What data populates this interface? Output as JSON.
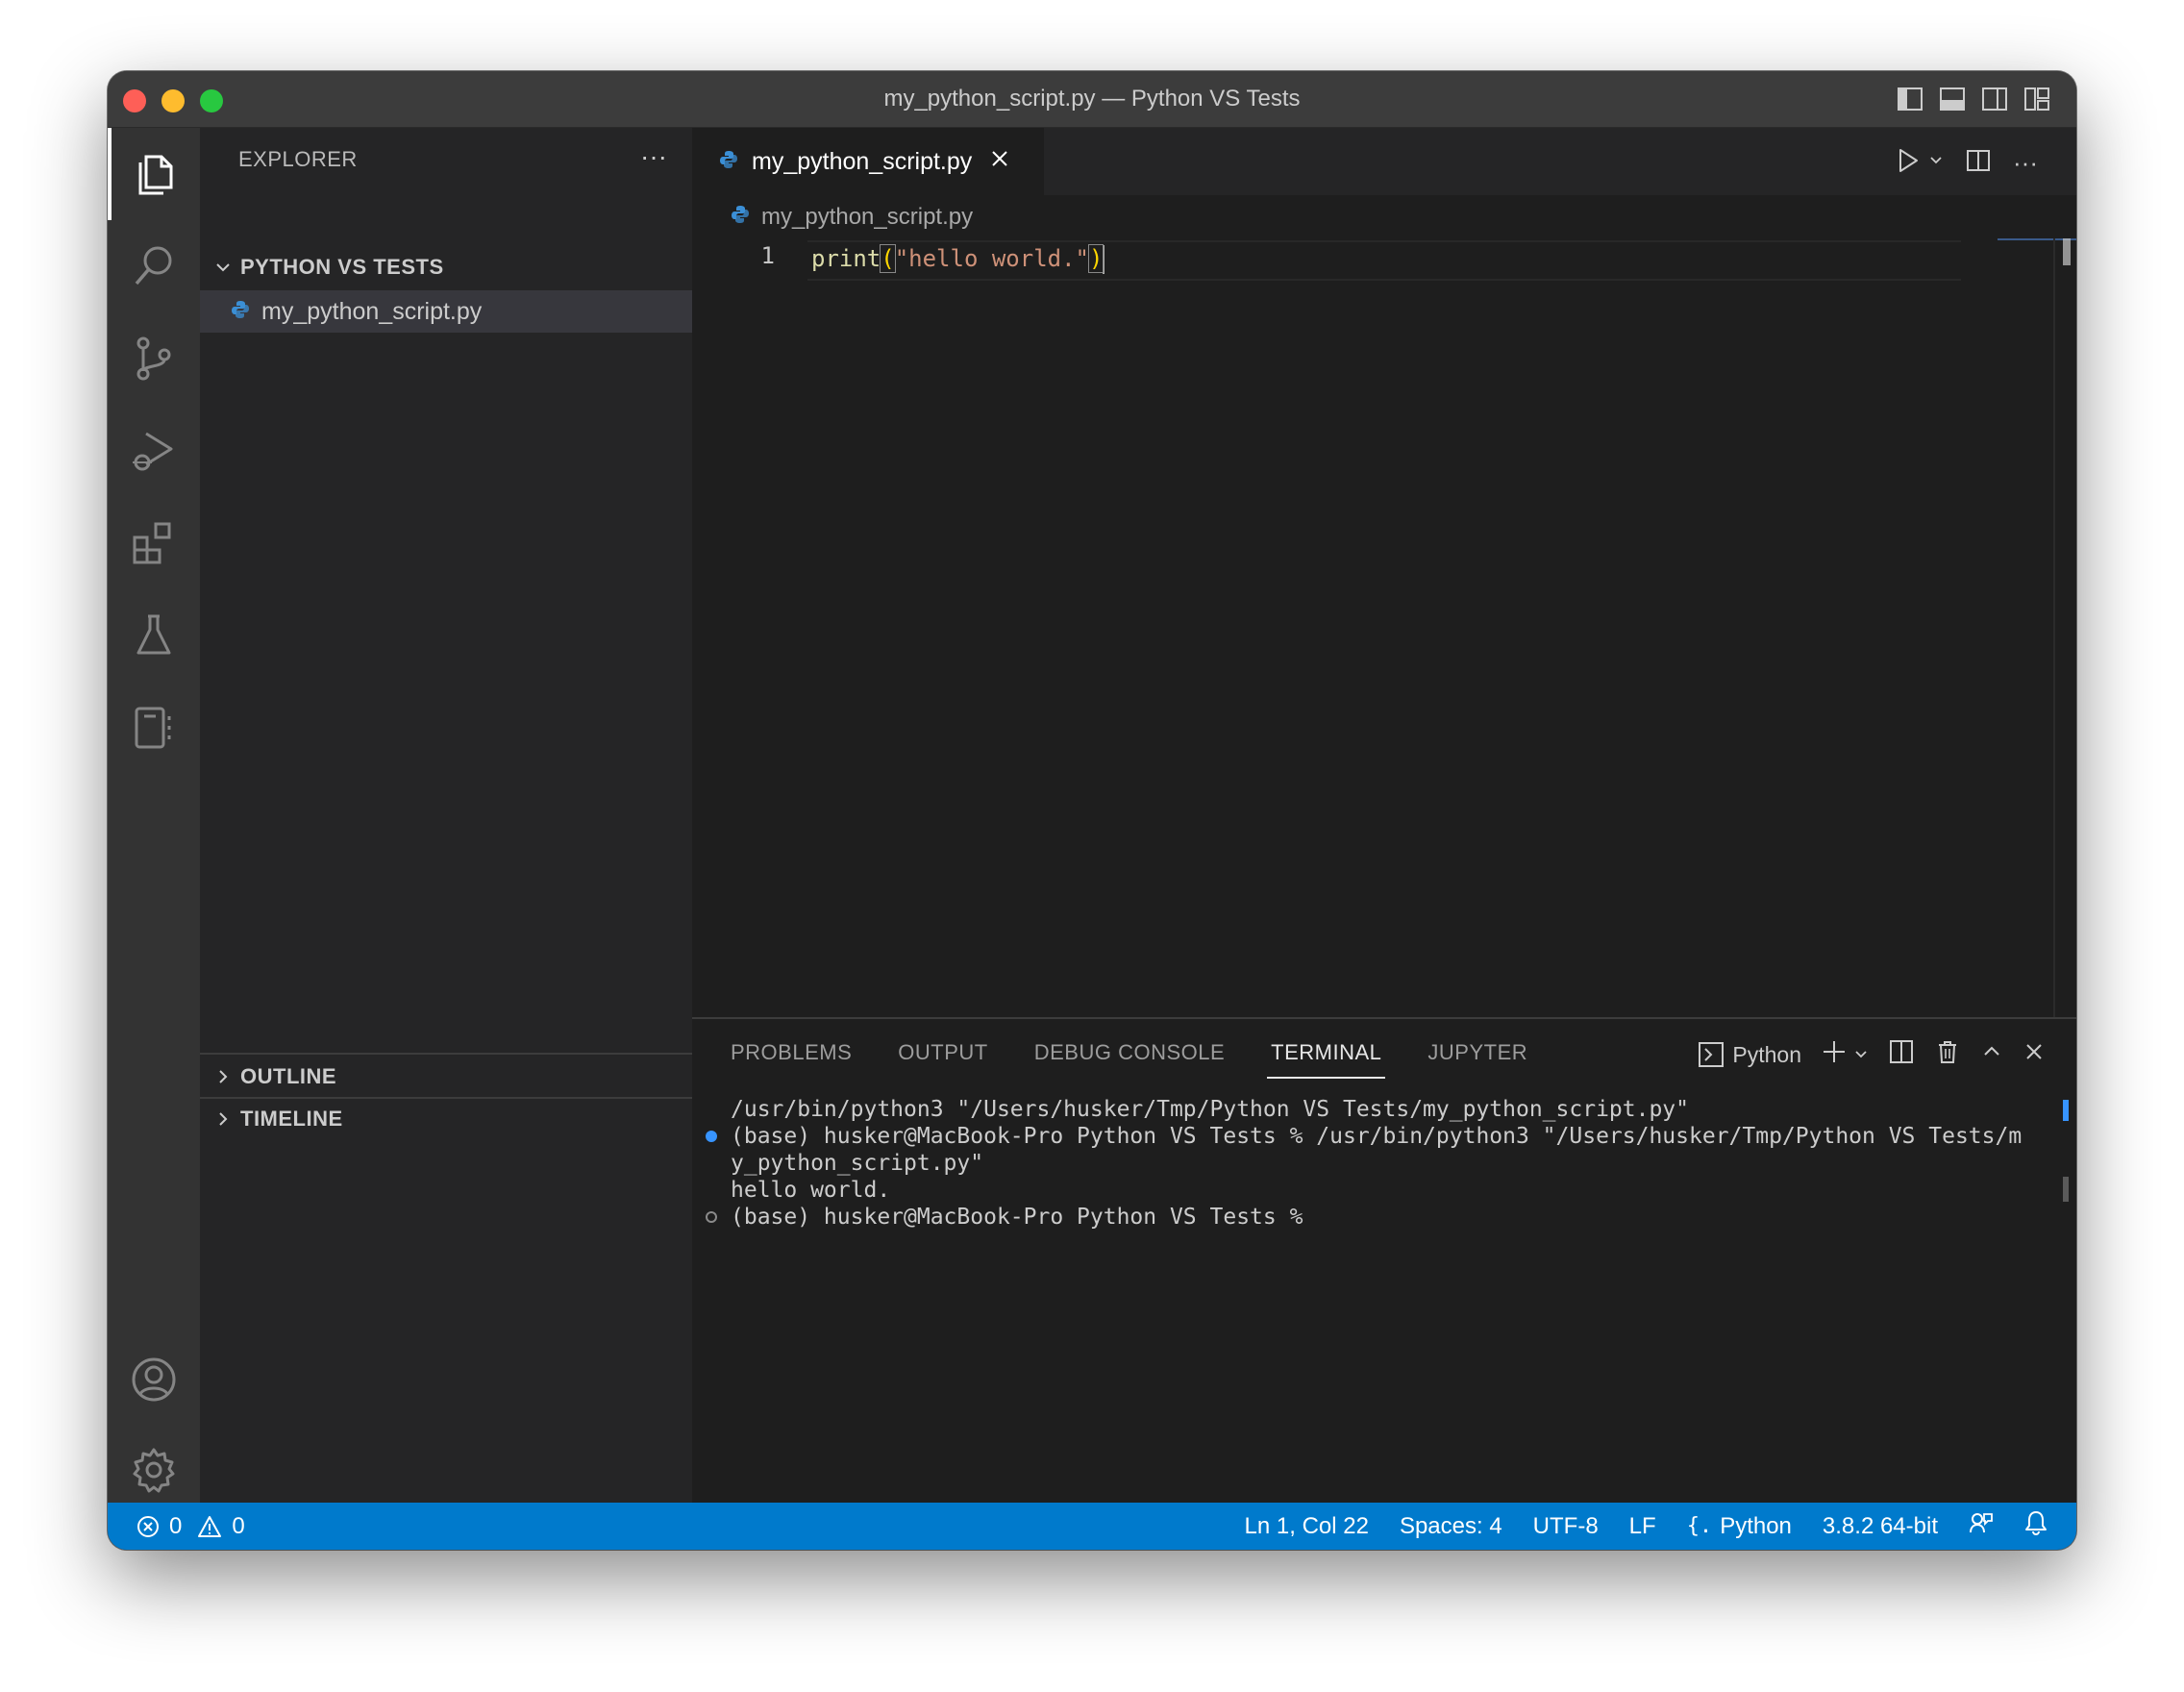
{
  "window": {
    "title": "my_python_script.py — Python VS Tests"
  },
  "sidebar": {
    "header": "EXPLORER",
    "folder": "PYTHON VS TESTS",
    "files": [
      {
        "name": "my_python_script.py"
      }
    ],
    "outline_label": "OUTLINE",
    "timeline_label": "TIMELINE"
  },
  "editor": {
    "tab_label": "my_python_script.py",
    "breadcrumb_file": "my_python_script.py",
    "line_number": "1",
    "code": {
      "fn": "print",
      "open_paren": "(",
      "string": "\"hello world.\"",
      "close_paren": ")"
    }
  },
  "panel": {
    "tabs": [
      "PROBLEMS",
      "OUTPUT",
      "DEBUG CONSOLE",
      "TERMINAL",
      "JUPYTER"
    ],
    "active_tab": "TERMINAL",
    "terminal_profile": "Python",
    "terminal_lines": [
      "/usr/bin/python3 \"/Users/husker/Tmp/Python VS Tests/my_python_script.py\"",
      "(base) husker@MacBook-Pro Python VS Tests % /usr/bin/python3 \"/Users/husker/Tmp/Python VS Tests/m",
      "y_python_script.py\"",
      "hello world.",
      "(base) husker@MacBook-Pro Python VS Tests % "
    ]
  },
  "statusbar": {
    "errors": "0",
    "warnings": "0",
    "cursor_position": "Ln 1, Col 22",
    "indentation": "Spaces: 4",
    "encoding": "UTF-8",
    "eol": "LF",
    "language": "Python",
    "interpreter": "3.8.2 64-bit"
  },
  "colors": {
    "accent": "#007acc",
    "editor_bg": "#1e1e1e",
    "sidebar_bg": "#252526",
    "activitybar_bg": "#333333"
  },
  "icons": [
    "files-icon",
    "search-icon",
    "source-control-icon",
    "run-debug-icon",
    "extensions-icon",
    "testing-icon",
    "notebook-icon",
    "account-icon",
    "settings-gear-icon"
  ]
}
